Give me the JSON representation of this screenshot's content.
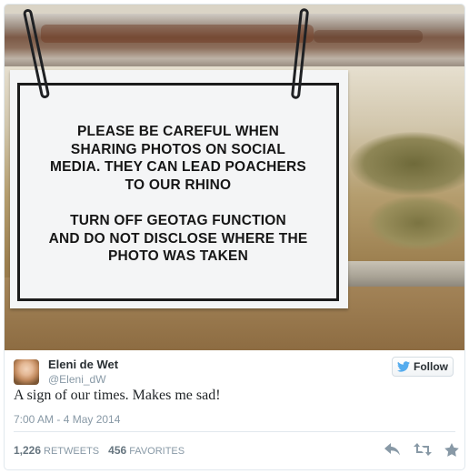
{
  "photo": {
    "sign_paragraph_1": [
      "PLEASE BE CAREFUL WHEN",
      "SHARING PHOTOS ON SOCIAL",
      "MEDIA. THEY CAN LEAD POACHERS",
      "TO OUR RHINO"
    ],
    "sign_paragraph_2": [
      "TURN OFF GEOTAG FUNCTION",
      "AND DO NOT DISCLOSE WHERE THE",
      "PHOTO WAS TAKEN"
    ]
  },
  "user": {
    "name": "Eleni de Wet",
    "handle": "@Eleni_dW"
  },
  "follow_button": {
    "label": "Follow",
    "icon": "twitter-bird-icon"
  },
  "tweet": {
    "text": "A sign of our times. Makes me sad!",
    "timestamp": "7:00 AM - 4 May 2014"
  },
  "stats": {
    "retweets_count": "1,226",
    "retweets_label": "RETWEETS",
    "favorites_count": "456",
    "favorites_label": "FAVORITES"
  },
  "actions": {
    "reply_icon": "reply-icon",
    "retweet_icon": "retweet-icon",
    "favorite_icon": "star-icon"
  },
  "colors": {
    "border": "#e1e8ed",
    "muted_text": "#8899a6",
    "action_gray": "#8899a6",
    "twitter_blue": "#55acee"
  }
}
